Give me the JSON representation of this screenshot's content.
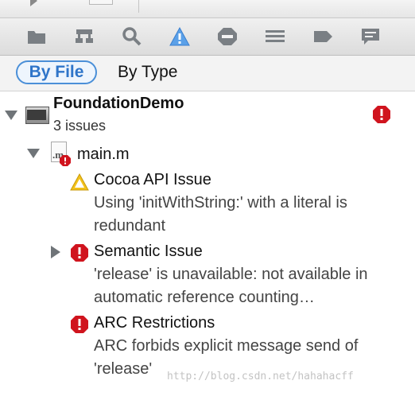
{
  "toolbar": {
    "icons": [
      "folder-icon",
      "hierarchy-icon",
      "search-icon",
      "warning-icon",
      "breakpoint-icon",
      "list-icon",
      "tag-icon",
      "comment-icon"
    ]
  },
  "filter": {
    "by_file": "By File",
    "by_type": "By Type"
  },
  "project": {
    "name": "FoundationDemo",
    "issues_count": "3 issues"
  },
  "file": {
    "name": "main.m"
  },
  "issues": [
    {
      "severity": "warning",
      "title": "Cocoa API Issue",
      "message": "Using 'initWithString:' with a literal is redundant"
    },
    {
      "severity": "error",
      "title": "Semantic Issue",
      "message": "'release' is unavailable: not available in automatic reference counting…"
    },
    {
      "severity": "error",
      "title": "ARC Restrictions",
      "message": "ARC forbids explicit message send of 'release'"
    }
  ],
  "watermark": "http://blog.csdn.net/hahahacff",
  "colors": {
    "accent": "#4a8fd8",
    "error": "#d0141e",
    "warning": "#f2c11b"
  }
}
